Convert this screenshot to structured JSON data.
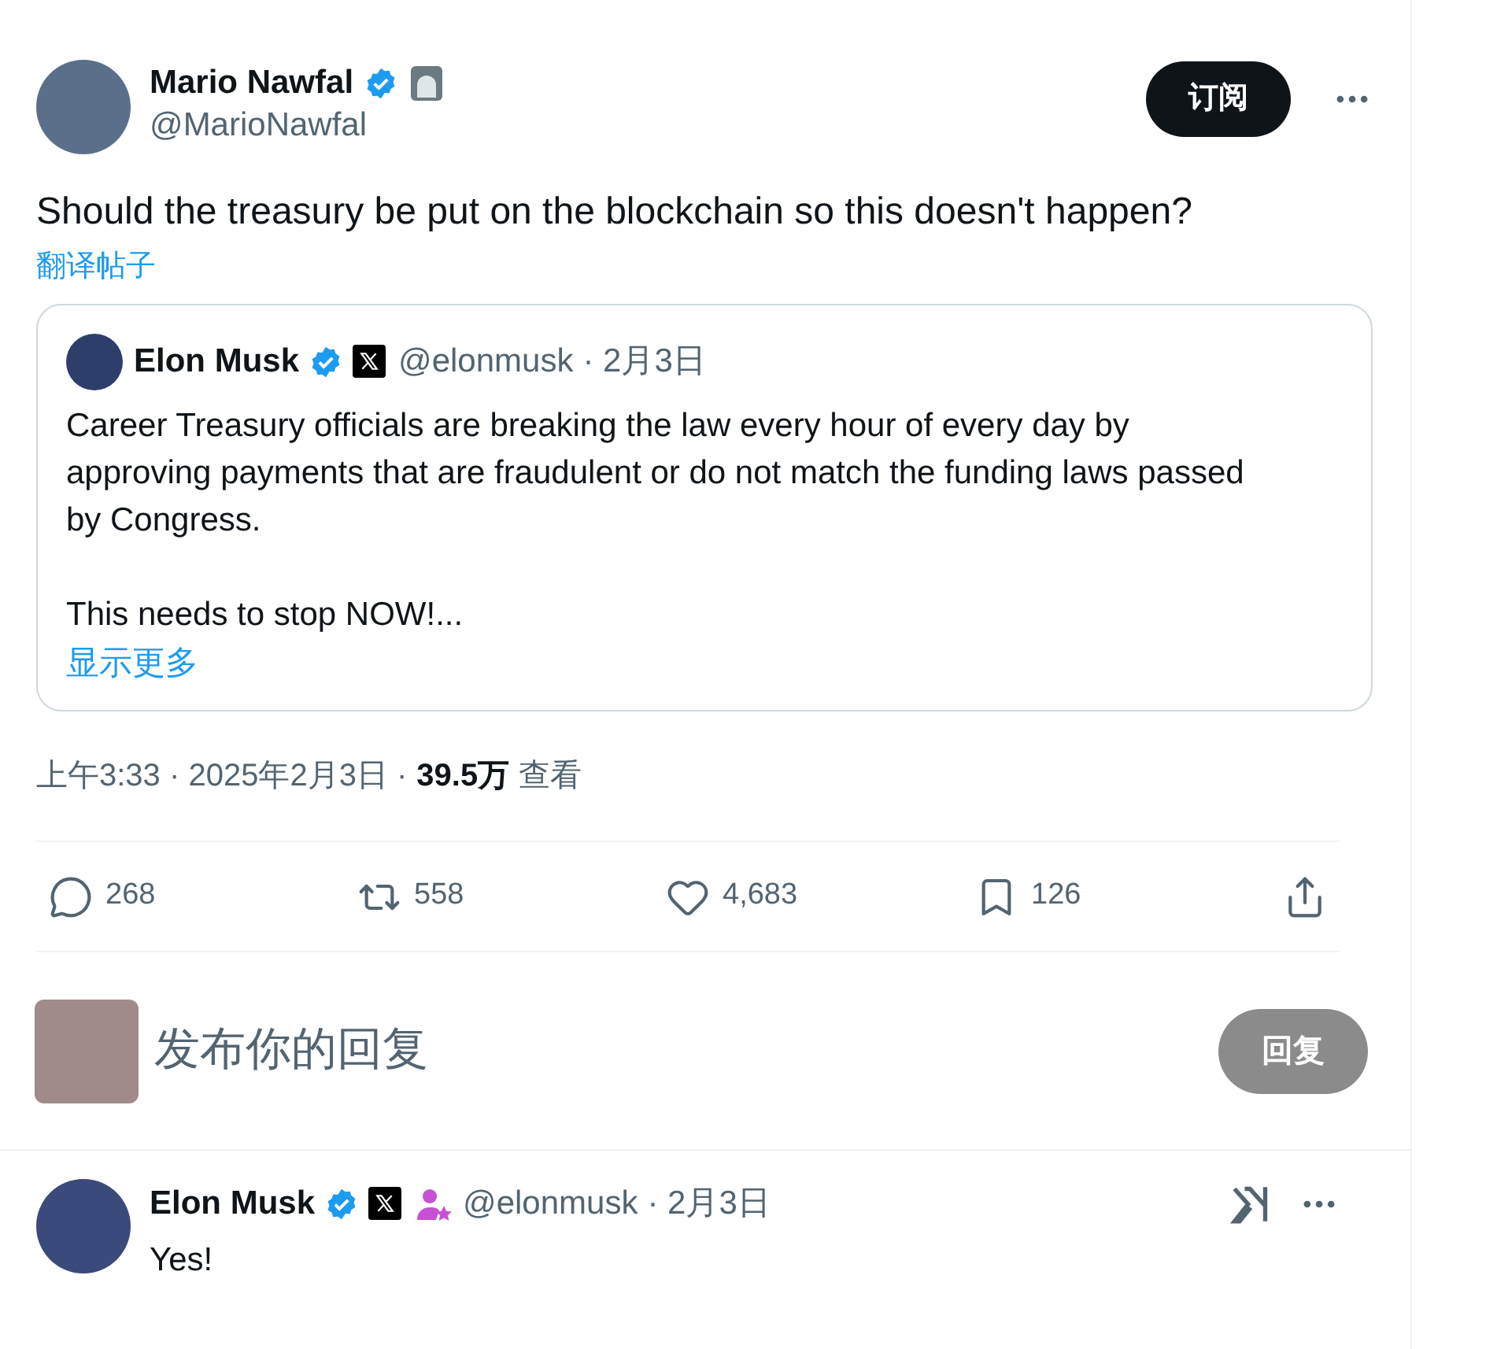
{
  "post": {
    "author": {
      "name": "Mario Nawfal",
      "handle": "@MarioNawfal"
    },
    "subscribe_button": "订阅",
    "text": "Should the treasury be put on the blockchain so this doesn't happen?",
    "translate_link": "翻译帖子",
    "quote": {
      "author": {
        "name": "Elon Musk",
        "handle": "@elonmusk",
        "date": "· 2月3日"
      },
      "paragraphs": [
        "Career Treasury officials are breaking the law every hour of every day by approving payments that are fraudulent or do not match the funding laws passed by Congress.",
        "This needs to stop NOW!..."
      ],
      "show_more": "显示更多"
    },
    "meta": {
      "time": "上午3:33 · 2025年2月3日 ·",
      "views": "39.5万",
      "views_label": "查看"
    },
    "actions": [
      {
        "kind": "reply",
        "count": "268"
      },
      {
        "kind": "repost",
        "count": "558"
      },
      {
        "kind": "like",
        "count": "4,683"
      },
      {
        "kind": "bookmark",
        "count": "126"
      },
      {
        "kind": "share"
      }
    ]
  },
  "composer": {
    "placeholder": "发布你的回复",
    "button": "回复",
    "disabled": true
  },
  "replies": [
    {
      "author": {
        "name": "Elon Musk",
        "handle": "@elonmusk",
        "date": "· 2月3日"
      },
      "text": "Yes!"
    }
  ]
}
